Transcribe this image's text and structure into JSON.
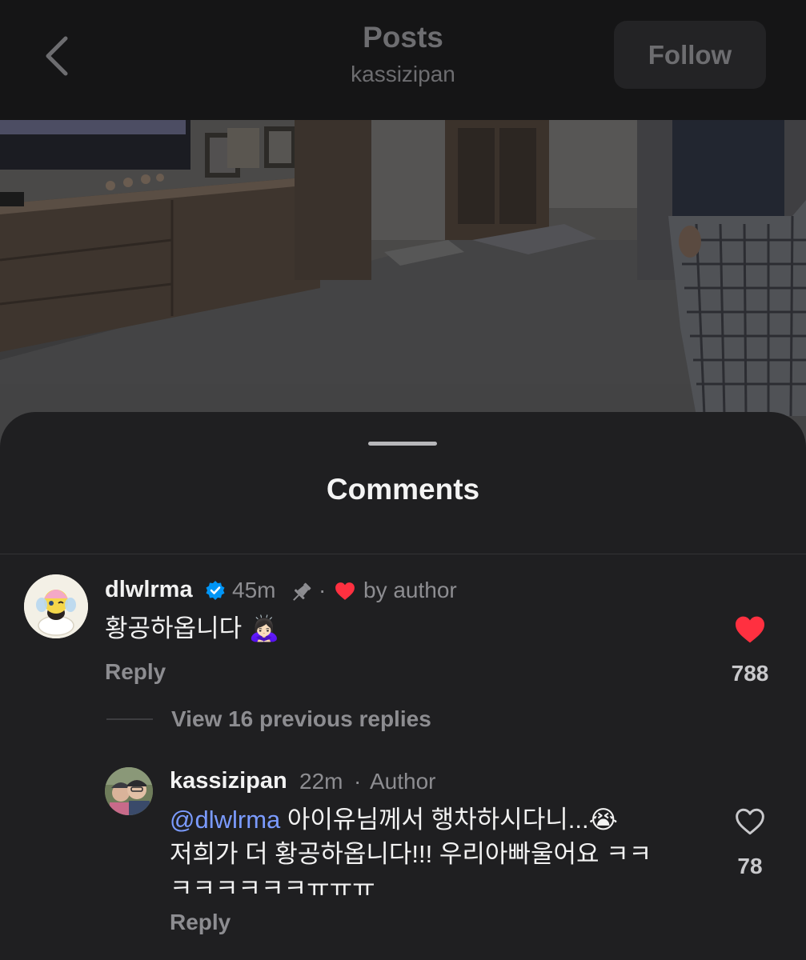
{
  "header": {
    "title": "Posts",
    "username": "kassizipan",
    "follow_label": "Follow"
  },
  "sheet": {
    "title": "Comments"
  },
  "comment": {
    "username": "dlwlrma",
    "verified": true,
    "time": "45m",
    "liked_by_author": "by author",
    "text": "황공하옵니다 🙇🏻‍♀️",
    "reply_label": "Reply",
    "likes": "788",
    "liked": true
  },
  "view_replies_label": "View 16 previous replies",
  "reply": {
    "username": "kassizipan",
    "time": "22m",
    "role": "Author",
    "mention": "@dlwlrma",
    "line1": "아이유님께서 행차하시다니...😭",
    "line2": "저희가 더 황공하옵니다!!! 우리아빠울어요 ㅋㅋ",
    "line3": "ㅋㅋㅋㅋㅋㅋㅠㅠㅠ",
    "reply_label": "Reply",
    "likes": "78",
    "liked": false
  },
  "colors": {
    "background": "#1f1f21",
    "header": "#151516",
    "like_red": "#ff3040",
    "mention_blue": "#7b9bff",
    "verified_blue": "#0095f6",
    "muted": "#8d8d91"
  },
  "icons": [
    "back-chevron-icon",
    "verified-badge-icon",
    "pin-icon",
    "heart-icon",
    "heart-outline-icon"
  ]
}
